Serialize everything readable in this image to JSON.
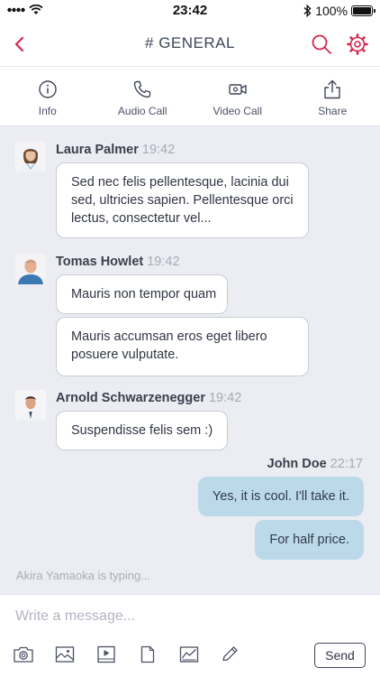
{
  "status_bar": {
    "time": "23:42",
    "battery": "100%"
  },
  "nav": {
    "title": "# GENERAL"
  },
  "colors": {
    "accent": "#d6264e",
    "outgoing_bubble": "#bcd9ea",
    "chat_background": "#ecedf3"
  },
  "toolbar": [
    {
      "label": "Info",
      "icon": "info-icon"
    },
    {
      "label": "Audio Call",
      "icon": "phone-icon"
    },
    {
      "label": "Video Call",
      "icon": "video-camera-icon"
    },
    {
      "label": "Share",
      "icon": "share-icon"
    }
  ],
  "messages": [
    {
      "sender": "Laura Palmer",
      "time": "19:42",
      "texts": [
        "Sed nec felis pellentesque, lacinia dui sed, ultricies sapien. Pellentesque orci lectus, consectetur vel..."
      ]
    },
    {
      "sender": "Tomas Howlet",
      "time": "19:42",
      "texts": [
        "Mauris non tempor quam",
        "Mauris accumsan eros eget libero posuere vulputate."
      ]
    },
    {
      "sender": "Arnold Schwarzenegger",
      "time": "19:42",
      "texts": [
        "Suspendisse felis sem :)"
      ]
    },
    {
      "sender": "John Doe",
      "time": "22:17",
      "texts": [
        "Yes, it is cool. I'll take it.",
        "For half price."
      ]
    }
  ],
  "typing_indicator": "Akira Yamaoka is typing...",
  "composer": {
    "placeholder": "Write a message...",
    "send_label": "Send",
    "attachments": [
      "camera-icon",
      "image-icon",
      "video-file-icon",
      "document-icon",
      "chart-icon",
      "pencil-icon"
    ]
  }
}
